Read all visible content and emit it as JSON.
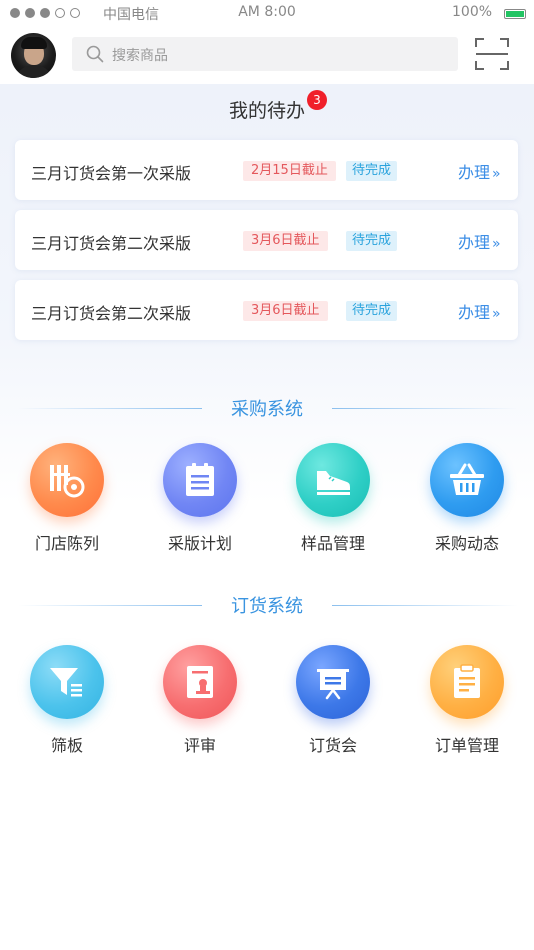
{
  "status_bar": {
    "carrier": "中国电信",
    "time": "AM 8:00",
    "battery": "100%"
  },
  "header": {
    "search_placeholder": "搜索商品"
  },
  "todo": {
    "title": "我的待办",
    "badge_count": "3",
    "items": [
      {
        "name": "三月订货会第一次采版",
        "deadline": "2月15日截止",
        "status": "待完成",
        "action": "办理"
      },
      {
        "name": "三月订货会第二次采版",
        "deadline": "3月6日截止",
        "status": "待完成",
        "action": "办理"
      },
      {
        "name": "三月订货会第二次采版",
        "deadline": "3月6日截止",
        "status": "待完成",
        "action": "办理"
      }
    ]
  },
  "purchase_system": {
    "title": "采购系统",
    "items": [
      {
        "label": "门店陈列",
        "icon": "store-display-icon",
        "color": "#ff8a4c"
      },
      {
        "label": "采版计划",
        "icon": "plan-clipboard-icon",
        "color": "#6f86f3"
      },
      {
        "label": "样品管理",
        "icon": "sneaker-icon",
        "color": "#2fcfc6"
      },
      {
        "label": "采购动态",
        "icon": "basket-icon",
        "color": "#2f9cf0"
      }
    ]
  },
  "order_system": {
    "title": "订货系统",
    "items": [
      {
        "label": "筛板",
        "icon": "filter-icon",
        "color": "#4cc3ec"
      },
      {
        "label": "评审",
        "icon": "review-icon",
        "color": "#f76e70"
      },
      {
        "label": "订货会",
        "icon": "presentation-icon",
        "color": "#3d78e8"
      },
      {
        "label": "订单管理",
        "icon": "order-clipboard-icon",
        "color": "#ffb044"
      }
    ]
  }
}
